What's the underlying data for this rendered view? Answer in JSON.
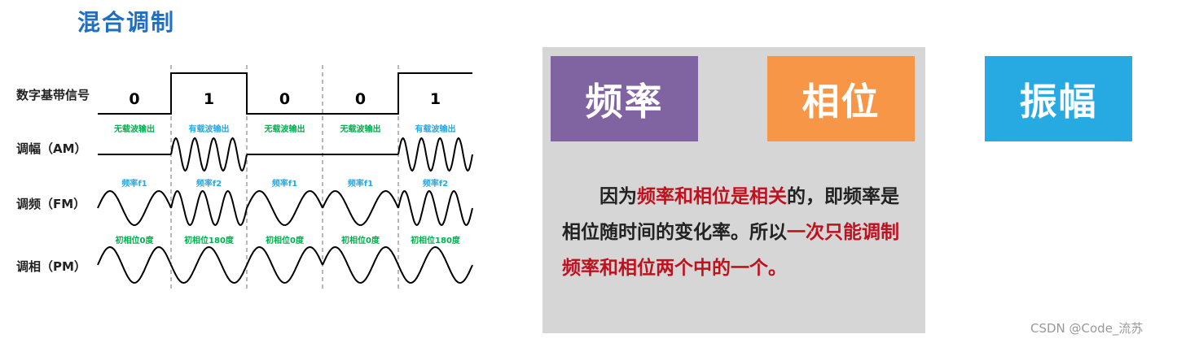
{
  "title": "混合调制",
  "rows": {
    "digital": "数字基带信号",
    "am": "调幅（AM）",
    "fm": "调频（FM）",
    "pm": "调相（PM）"
  },
  "bits": [
    "0",
    "1",
    "0",
    "0",
    "1"
  ],
  "am_labels": [
    "无载波输出",
    "有载波输出",
    "无载波输出",
    "无载波输出",
    "有载波输出"
  ],
  "fm_labels": [
    "频率f1",
    "频率f2",
    "频率f1",
    "频率f1",
    "频率f2"
  ],
  "pm_labels": [
    "初相位0度",
    "初相位180度",
    "初相位0度",
    "初相位0度",
    "初相位180度"
  ],
  "cards": {
    "frequency": "频率",
    "phase": "相位",
    "amplitude": "振幅"
  },
  "note": {
    "p1": "因为",
    "p2": "频率和相位是相关",
    "p3": "的，即频率是相位随时间的变化率。所以",
    "p4": "一次只能调制频率和相位两个中的一个。"
  },
  "credit": "CSDN @Code_流苏",
  "colors": {
    "title": "#1f6fc2",
    "am_label": "#00b050",
    "fm_label": "#27a9e1",
    "card_frequency": "#8064a2",
    "card_phase": "#f79646",
    "card_amplitude": "#27a9e1",
    "highlight": "#c0111f"
  }
}
